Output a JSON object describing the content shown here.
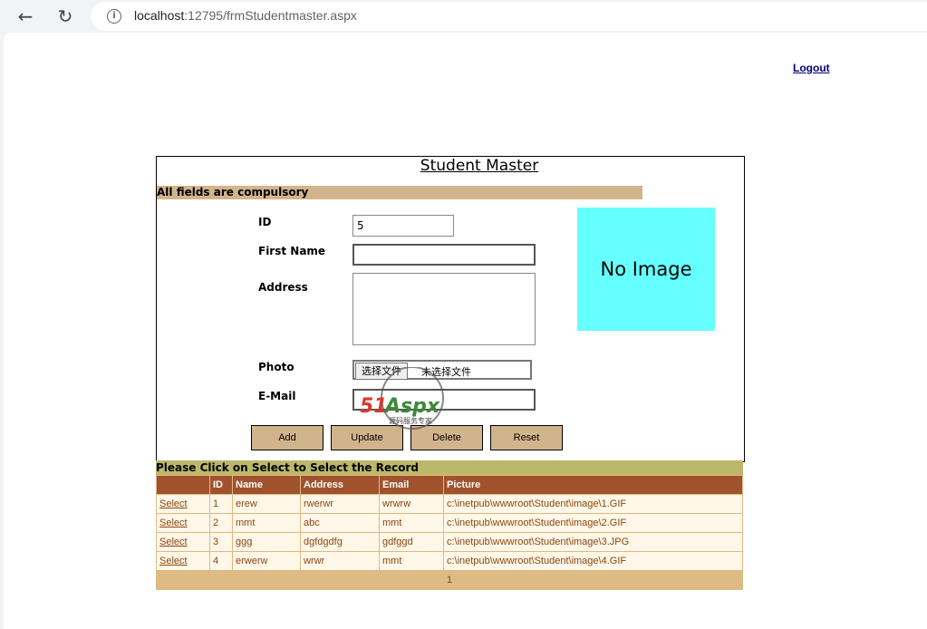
{
  "browser": {
    "url_host": "localhost",
    "url_rest": ":12795/frmStudentmaster.aspx"
  },
  "header": {
    "logout_label": "Logout"
  },
  "form": {
    "title": "Student Master",
    "notice": "All fields are compulsory",
    "id_label": "ID",
    "id_value": "5",
    "first_name_label": "First Name",
    "first_name_value": "",
    "address_label": "Address",
    "address_value": "",
    "photo_label": "Photo",
    "file_button_label": "选择文件",
    "file_status": "未选择文件",
    "email_label": "E-Mail",
    "email_value": "",
    "no_image_text": "No Image",
    "buttons": {
      "add": "Add",
      "update": "Update",
      "delete": "Delete",
      "reset": "Reset"
    }
  },
  "watermark": {
    "brand": "51Aspx",
    "tagline": "源码服务专家"
  },
  "grid": {
    "caption": "Please Click on Select to Select the Record",
    "columns": [
      "",
      "ID",
      "Name",
      "Address",
      "Email",
      "Picture"
    ],
    "rows": [
      {
        "select": "Select",
        "id": "1",
        "name": "erew",
        "address": "rwerwr",
        "email": "wrwrw",
        "picture": "c:\\inetpub\\wwwroot\\Student\\image\\1.GIF"
      },
      {
        "select": "Select",
        "id": "2",
        "name": "mmt",
        "address": "abc",
        "email": "mmt",
        "picture": "c:\\inetpub\\wwwroot\\Student\\image\\2.GIF"
      },
      {
        "select": "Select",
        "id": "3",
        "name": "ggg",
        "address": "dgfdgdfg",
        "email": "gdfggd",
        "picture": "c:\\inetpub\\wwwroot\\Student\\image\\3.JPG"
      },
      {
        "select": "Select",
        "id": "4",
        "name": "erwerw",
        "address": "wrwr",
        "email": "mmt",
        "picture": "c:\\inetpub\\wwwroot\\Student\\image\\4.GIF"
      }
    ],
    "pager": "1"
  },
  "colors": {
    "tan": "#d2b48c",
    "header_brown": "#a0522d",
    "row_bg": "#fff7e7",
    "caption_olive": "#bdb76b",
    "no_image_bg": "#66ffff"
  }
}
